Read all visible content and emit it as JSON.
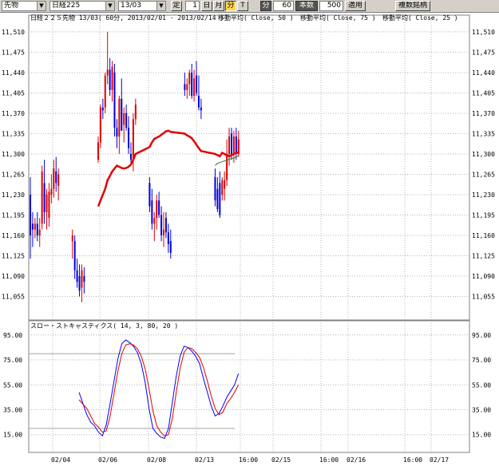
{
  "toolbar": {
    "instrument_type": "先物",
    "instrument": "日経225",
    "contract_month": "13/03",
    "buttons": {
      "fixed": "定",
      "daily": "日",
      "monthly": "月",
      "minute": "分",
      "tick": "T"
    },
    "interval_label": "分",
    "interval_value": "60",
    "bars_label": "本数",
    "bars_value": "500",
    "apply_label": "適用",
    "multi_label": "複数銘柄"
  },
  "colors": {
    "up": "#e00000",
    "down": "#0000e0",
    "ma50": "#e00000",
    "ma75": "#2e7d2e",
    "stoch_k": "#0000ff",
    "stoch_d": "#e00000",
    "grid": "#b4b4b4"
  },
  "chart_data": [
    {
      "type": "candlestick",
      "title": "日経２２５先物 13/03( 60分, 2013/02/01 - 2013/02/14 )",
      "legend": [
        "移動平均( Close, 50 )",
        "移動平均( Close, 75 )",
        "移動平均( Close, 25 )"
      ],
      "y_ticks": [
        "11,510",
        "11,475",
        "11,440",
        "11,405",
        "11,370",
        "11,335",
        "11,300",
        "11,265",
        "11,230",
        "11,195",
        "11,160",
        "11,125",
        "11,090",
        "11,055"
      ],
      "ylim": [
        11020,
        11525
      ],
      "grid": true,
      "candles": [
        {
          "t": 0,
          "o": 11230,
          "h": 11260,
          "l": 11120,
          "c": 11160
        },
        {
          "t": 1,
          "o": 11180,
          "h": 11200,
          "l": 11140,
          "c": 11170
        },
        {
          "t": 2,
          "o": 11170,
          "h": 11190,
          "l": 11155,
          "c": 11180
        },
        {
          "t": 3,
          "o": 11180,
          "h": 11200,
          "l": 11150,
          "c": 11160
        },
        {
          "t": 4,
          "o": 11160,
          "h": 11190,
          "l": 11140,
          "c": 11170
        },
        {
          "t": 5,
          "o": 11180,
          "h": 11280,
          "l": 11170,
          "c": 11270
        },
        {
          "t": 6,
          "o": 11250,
          "h": 11290,
          "l": 11180,
          "c": 11200
        },
        {
          "t": 7,
          "o": 11200,
          "h": 11240,
          "l": 11170,
          "c": 11230
        },
        {
          "t": 8,
          "o": 11190,
          "h": 11250,
          "l": 11175,
          "c": 11235
        },
        {
          "t": 9,
          "o": 11230,
          "h": 11265,
          "l": 11215,
          "c": 11240
        },
        {
          "t": 10,
          "o": 11240,
          "h": 11290,
          "l": 11225,
          "c": 11275
        },
        {
          "t": 11,
          "o": 11270,
          "h": 11295,
          "l": 11235,
          "c": 11250
        },
        {
          "t": 12,
          "o": 11245,
          "h": 11275,
          "l": 11220,
          "c": 11265
        },
        {
          "t": 18,
          "o": 11150,
          "h": 11170,
          "l": 11120,
          "c": 11160
        },
        {
          "t": 19,
          "o": 11150,
          "h": 11160,
          "l": 11085,
          "c": 11100
        },
        {
          "t": 20,
          "o": 11100,
          "h": 11120,
          "l": 11070,
          "c": 11080
        },
        {
          "t": 21,
          "o": 11090,
          "h": 11110,
          "l": 11055,
          "c": 11065
        },
        {
          "t": 22,
          "o": 11070,
          "h": 11110,
          "l": 11045,
          "c": 11100
        },
        {
          "t": 23,
          "o": 11090,
          "h": 11105,
          "l": 11060,
          "c": 11080
        },
        {
          "t": 29,
          "o": 11290,
          "h": 11330,
          "l": 11285,
          "c": 11320
        },
        {
          "t": 30,
          "o": 11320,
          "h": 11385,
          "l": 11310,
          "c": 11380
        },
        {
          "t": 31,
          "o": 11380,
          "h": 11395,
          "l": 11360,
          "c": 11375
        },
        {
          "t": 32,
          "o": 11380,
          "h": 11440,
          "l": 11370,
          "c": 11435
        },
        {
          "t": 33,
          "o": 11435,
          "h": 11510,
          "l": 11420,
          "c": 11445
        },
        {
          "t": 34,
          "o": 11445,
          "h": 11465,
          "l": 11400,
          "c": 11410
        },
        {
          "t": 35,
          "o": 11410,
          "h": 11460,
          "l": 11390,
          "c": 11450
        },
        {
          "t": 36,
          "o": 11440,
          "h": 11455,
          "l": 11330,
          "c": 11345
        },
        {
          "t": 37,
          "o": 11345,
          "h": 11360,
          "l": 11310,
          "c": 11330
        },
        {
          "t": 38,
          "o": 11330,
          "h": 11400,
          "l": 11300,
          "c": 11395
        },
        {
          "t": 39,
          "o": 11395,
          "h": 11430,
          "l": 11340,
          "c": 11340
        },
        {
          "t": 40,
          "o": 11350,
          "h": 11380,
          "l": 11320,
          "c": 11370
        },
        {
          "t": 41,
          "o": 11370,
          "h": 11385,
          "l": 11340,
          "c": 11345
        },
        {
          "t": 42,
          "o": 11345,
          "h": 11365,
          "l": 11300,
          "c": 11310
        },
        {
          "t": 43,
          "o": 11300,
          "h": 11320,
          "l": 11280,
          "c": 11290
        },
        {
          "t": 44,
          "o": 11290,
          "h": 11370,
          "l": 11270,
          "c": 11360
        },
        {
          "t": 45,
          "o": 11360,
          "h": 11395,
          "l": 11350,
          "c": 11385
        },
        {
          "t": 51,
          "o": 11250,
          "h": 11260,
          "l": 11200,
          "c": 11210
        },
        {
          "t": 52,
          "o": 11220,
          "h": 11240,
          "l": 11170,
          "c": 11180
        },
        {
          "t": 53,
          "o": 11180,
          "h": 11200,
          "l": 11150,
          "c": 11190
        },
        {
          "t": 54,
          "o": 11190,
          "h": 11230,
          "l": 11170,
          "c": 11220
        },
        {
          "t": 55,
          "o": 11220,
          "h": 11235,
          "l": 11190,
          "c": 11195
        },
        {
          "t": 56,
          "o": 11195,
          "h": 11210,
          "l": 11150,
          "c": 11160
        },
        {
          "t": 57,
          "o": 11160,
          "h": 11200,
          "l": 11140,
          "c": 11170
        },
        {
          "t": 58,
          "o": 11190,
          "h": 11200,
          "l": 11155,
          "c": 11165
        },
        {
          "t": 59,
          "o": 11165,
          "h": 11180,
          "l": 11130,
          "c": 11145
        },
        {
          "t": 60,
          "o": 11150,
          "h": 11170,
          "l": 11120,
          "c": 11130
        },
        {
          "t": 66,
          "o": 11420,
          "h": 11440,
          "l": 11400,
          "c": 11410
        },
        {
          "t": 67,
          "o": 11410,
          "h": 11430,
          "l": 11395,
          "c": 11420
        },
        {
          "t": 68,
          "o": 11420,
          "h": 11445,
          "l": 11400,
          "c": 11440
        },
        {
          "t": 69,
          "o": 11440,
          "h": 11455,
          "l": 11395,
          "c": 11400
        },
        {
          "t": 70,
          "o": 11400,
          "h": 11445,
          "l": 11390,
          "c": 11430
        },
        {
          "t": 71,
          "o": 11435,
          "h": 11460,
          "l": 11400,
          "c": 11405
        },
        {
          "t": 72,
          "o": 11400,
          "h": 11435,
          "l": 11375,
          "c": 11380
        },
        {
          "t": 73,
          "o": 11380,
          "h": 11395,
          "l": 11360,
          "c": 11375
        },
        {
          "t": 79,
          "o": 11260,
          "h": 11275,
          "l": 11210,
          "c": 11220
        },
        {
          "t": 80,
          "o": 11240,
          "h": 11260,
          "l": 11200,
          "c": 11205
        },
        {
          "t": 81,
          "o": 11250,
          "h": 11270,
          "l": 11190,
          "c": 11195
        },
        {
          "t": 82,
          "o": 11230,
          "h": 11260,
          "l": 11220,
          "c": 11255
        },
        {
          "t": 83,
          "o": 11240,
          "h": 11270,
          "l": 11220,
          "c": 11255
        },
        {
          "t": 84,
          "o": 11255,
          "h": 11325,
          "l": 11245,
          "c": 11300
        },
        {
          "t": 85,
          "o": 11300,
          "h": 11345,
          "l": 11280,
          "c": 11330
        },
        {
          "t": 86,
          "o": 11335,
          "h": 11345,
          "l": 11290,
          "c": 11300
        },
        {
          "t": 87,
          "o": 11300,
          "h": 11340,
          "l": 11285,
          "c": 11330
        },
        {
          "t": 88,
          "o": 11330,
          "h": 11345,
          "l": 11290,
          "c": 11300
        },
        {
          "t": 89,
          "o": 11300,
          "h": 11340,
          "l": 11295,
          "c": 11325
        }
      ],
      "ma_series": [
        {
          "name": "移動平均( Close, 50 )",
          "points": [
            [
              29,
              11210
            ],
            [
              30,
              11220
            ],
            [
              31,
              11230
            ],
            [
              32,
              11240
            ],
            [
              33,
              11255
            ],
            [
              34,
              11262
            ],
            [
              35,
              11270
            ],
            [
              36,
              11275
            ],
            [
              37,
              11280
            ],
            [
              38,
              11278
            ],
            [
              39,
              11276
            ],
            [
              40,
              11275
            ],
            [
              41,
              11276
            ],
            [
              42,
              11278
            ],
            [
              43,
              11282
            ],
            [
              44,
              11290
            ],
            [
              45,
              11300
            ],
            [
              51,
              11312
            ],
            [
              52,
              11320
            ],
            [
              53,
              11326
            ],
            [
              54,
              11328
            ],
            [
              55,
              11330
            ],
            [
              56,
              11333
            ],
            [
              57,
              11336
            ],
            [
              58,
              11339
            ],
            [
              59,
              11340
            ],
            [
              60,
              11338
            ],
            [
              66,
              11335
            ],
            [
              67,
              11332
            ],
            [
              68,
              11330
            ],
            [
              69,
              11327
            ],
            [
              70,
              11322
            ],
            [
              71,
              11316
            ],
            [
              72,
              11310
            ],
            [
              73,
              11305
            ],
            [
              79,
              11300
            ],
            [
              80,
              11298
            ],
            [
              81,
              11296
            ],
            [
              82,
              11302
            ],
            [
              83,
              11300
            ],
            [
              84,
              11298
            ],
            [
              85,
              11296
            ],
            [
              86,
              11298
            ],
            [
              87,
              11300
            ],
            [
              88,
              11302
            ],
            [
              89,
              11303
            ]
          ]
        },
        {
          "name": "移動平均( Close, 75 )",
          "points": [
            [
              79,
              11280
            ],
            [
              80,
              11284
            ],
            [
              81,
              11285
            ],
            [
              82,
              11287
            ],
            [
              83,
              11288
            ],
            [
              84,
              11289
            ],
            [
              85,
              11291
            ],
            [
              86,
              11292
            ],
            [
              87,
              11293
            ],
            [
              88,
              11295
            ],
            [
              89,
              11297
            ]
          ]
        }
      ]
    },
    {
      "type": "line",
      "title": "スロー・ストキャスティクス( 14, 3, 80, 20 )",
      "y_ticks": [
        "95.00",
        "75.00",
        "55.00",
        "35.00",
        "15.00"
      ],
      "ylim": [
        2,
        100
      ],
      "ref_lines": [
        80,
        20
      ],
      "x_tick_labels": [
        "02/04",
        "02/06",
        "02/08",
        "02/13",
        "16:00",
        "02/15",
        "16:00",
        "02/16",
        "16:00",
        "02/17"
      ],
      "series": [
        {
          "name": "%K",
          "values": [
            [
              0,
              49
            ],
            [
              2,
              31
            ],
            [
              3,
              25
            ],
            [
              4,
              22
            ],
            [
              5,
              17
            ],
            [
              6,
              14
            ],
            [
              7,
              23
            ],
            [
              8,
              40
            ],
            [
              9,
              58
            ],
            [
              10,
              76
            ],
            [
              11,
              88
            ],
            [
              12,
              91
            ],
            [
              13,
              89
            ],
            [
              14,
              86
            ],
            [
              15,
              81
            ],
            [
              16,
              72
            ],
            [
              17,
              57
            ],
            [
              18,
              36
            ],
            [
              19,
              20
            ],
            [
              20,
              16
            ],
            [
              21,
              13
            ],
            [
              22,
              12
            ],
            [
              23,
              20
            ],
            [
              24,
              41
            ],
            [
              25,
              62
            ],
            [
              26,
              78
            ],
            [
              27,
              86
            ],
            [
              28,
              85
            ],
            [
              29,
              82
            ],
            [
              30,
              78
            ],
            [
              31,
              72
            ],
            [
              32,
              60
            ],
            [
              33,
              49
            ],
            [
              34,
              38
            ],
            [
              35,
              30
            ],
            [
              36,
              32
            ],
            [
              37,
              38
            ],
            [
              38,
              45
            ],
            [
              39,
              50
            ],
            [
              40,
              55
            ],
            [
              41,
              64
            ]
          ]
        },
        {
          "name": "%D",
          "values": [
            [
              0,
              43
            ],
            [
              2,
              36
            ],
            [
              3,
              30
            ],
            [
              4,
              24
            ],
            [
              5,
              21
            ],
            [
              6,
              17
            ],
            [
              7,
              18
            ],
            [
              8,
              30
            ],
            [
              9,
              48
            ],
            [
              10,
              66
            ],
            [
              11,
              80
            ],
            [
              12,
              87
            ],
            [
              13,
              88
            ],
            [
              14,
              87
            ],
            [
              15,
              84
            ],
            [
              16,
              78
            ],
            [
              17,
              68
            ],
            [
              18,
              52
            ],
            [
              19,
              34
            ],
            [
              20,
              22
            ],
            [
              21,
              17
            ],
            [
              22,
              14
            ],
            [
              23,
              15
            ],
            [
              24,
              28
            ],
            [
              25,
              49
            ],
            [
              26,
              68
            ],
            [
              27,
              81
            ],
            [
              28,
              85
            ],
            [
              29,
              84
            ],
            [
              30,
              81
            ],
            [
              31,
              77
            ],
            [
              32,
              69
            ],
            [
              33,
              58
            ],
            [
              34,
              46
            ],
            [
              35,
              36
            ],
            [
              36,
              31
            ],
            [
              37,
              33
            ],
            [
              38,
              40
            ],
            [
              39,
              44
            ],
            [
              40,
              49
            ],
            [
              41,
              55
            ]
          ]
        }
      ]
    }
  ]
}
